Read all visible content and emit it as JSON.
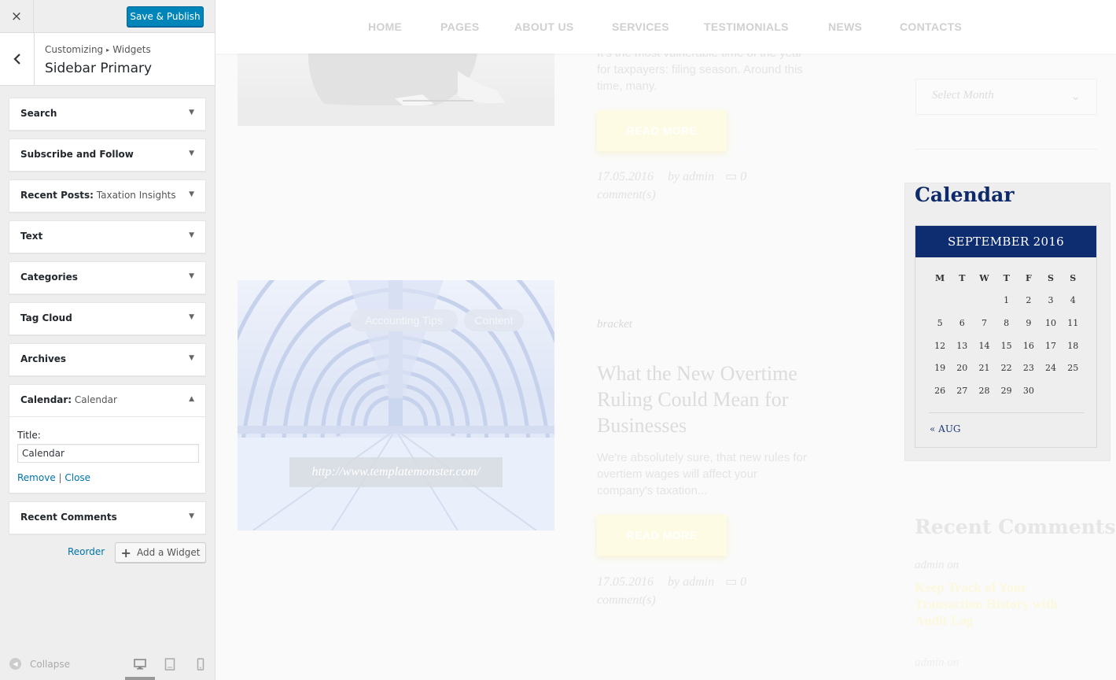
{
  "customizer": {
    "close_icon": "×",
    "save_label": "Save & Publish",
    "breadcrumb": [
      "Customizing",
      "Widgets"
    ],
    "breadcrumb_sep": "▸",
    "section_title": "Sidebar Primary",
    "widgets": [
      {
        "title": "Search",
        "subtitle": ""
      },
      {
        "title": "Subscribe and Follow",
        "subtitle": ""
      },
      {
        "title": "Recent Posts:",
        "subtitle": " Taxation Insights"
      },
      {
        "title": "Text",
        "subtitle": ""
      },
      {
        "title": "Categories",
        "subtitle": ""
      },
      {
        "title": "Tag Cloud",
        "subtitle": ""
      },
      {
        "title": "Archives",
        "subtitle": ""
      },
      {
        "title": "Calendar:",
        "subtitle": " Calendar"
      },
      {
        "title": "Recent Comments",
        "subtitle": ""
      }
    ],
    "expanded_widget": {
      "field_label": "Title:",
      "field_value": "Calendar",
      "remove_label": "Remove",
      "sep": " | ",
      "close_label": "Close"
    },
    "reorder_label": "Reorder",
    "add_widget_label": "Add a Widget",
    "collapse_label": "Collapse",
    "icons": {
      "close": "close-icon",
      "back": "chevron-left-icon",
      "toggle_down": "arrow-down-icon",
      "toggle_up": "arrow-up-icon",
      "add": "plus-icon",
      "collapse": "collapse-icon",
      "desktop": "desktop-icon",
      "tablet": "tablet-icon",
      "mobile": "mobile-icon"
    },
    "colors": {
      "primary_button": "#0085ba",
      "link": "#0073aa"
    }
  },
  "preview": {
    "nav": [
      "HOME",
      "PAGES",
      "ABOUT US",
      "SERVICES",
      "TESTIMONIALS",
      "NEWS",
      "CONTACTS"
    ],
    "post1": {
      "excerpt": [
        "It's the most vulnerable time of the year",
        "for taxpayers: filing season. Around this",
        "time, many."
      ],
      "read_more": "READ MORE",
      "date": "17.05.2016",
      "by": "by admin",
      "comments_count": "0",
      "comments_label": "comment(s)"
    },
    "post2": {
      "tags": [
        "Accounting Tips",
        "Content"
      ],
      "image_url": "http://www.templatemonster.com/",
      "category": "bracket",
      "title": [
        "What the New Overtime",
        "Ruling Could Mean for",
        "Businesses"
      ],
      "excerpt": [
        "We're absolutely sure, that new rules for",
        "overtiem wages will affect your",
        "company's taxation..."
      ],
      "read_more": "READ MORE",
      "date": "17.05.2016",
      "by": "by admin",
      "comments_count": "0",
      "comments_label": "comment(s)"
    },
    "archives_select": {
      "placeholder": "Select Month",
      "chevron": "⌄"
    },
    "calendar": {
      "title": "Calendar",
      "month": "SEPTEMBER 2016",
      "dow": [
        "M",
        "T",
        "W",
        "T",
        "F",
        "S",
        "S"
      ],
      "weeks": [
        [
          "",
          "",
          "",
          "1",
          "2",
          "3",
          "4"
        ],
        [
          "5",
          "6",
          "7",
          "8",
          "9",
          "10",
          "11"
        ],
        [
          "12",
          "13",
          "14",
          "15",
          "16",
          "17",
          "18"
        ],
        [
          "19",
          "20",
          "21",
          "22",
          "23",
          "24",
          "25"
        ],
        [
          "26",
          "27",
          "28",
          "29",
          "30",
          "",
          ""
        ]
      ],
      "prev": "« AUG",
      "colors": {
        "header": "#0e2c70",
        "title": "#0e2a6b"
      }
    },
    "recent_comments": {
      "title": "Recent Comments",
      "items": [
        {
          "author": "admin on",
          "link": "Keep Track of Your Transaction History with Audit Log"
        },
        {
          "author": "admin on",
          "link": ""
        }
      ]
    }
  }
}
